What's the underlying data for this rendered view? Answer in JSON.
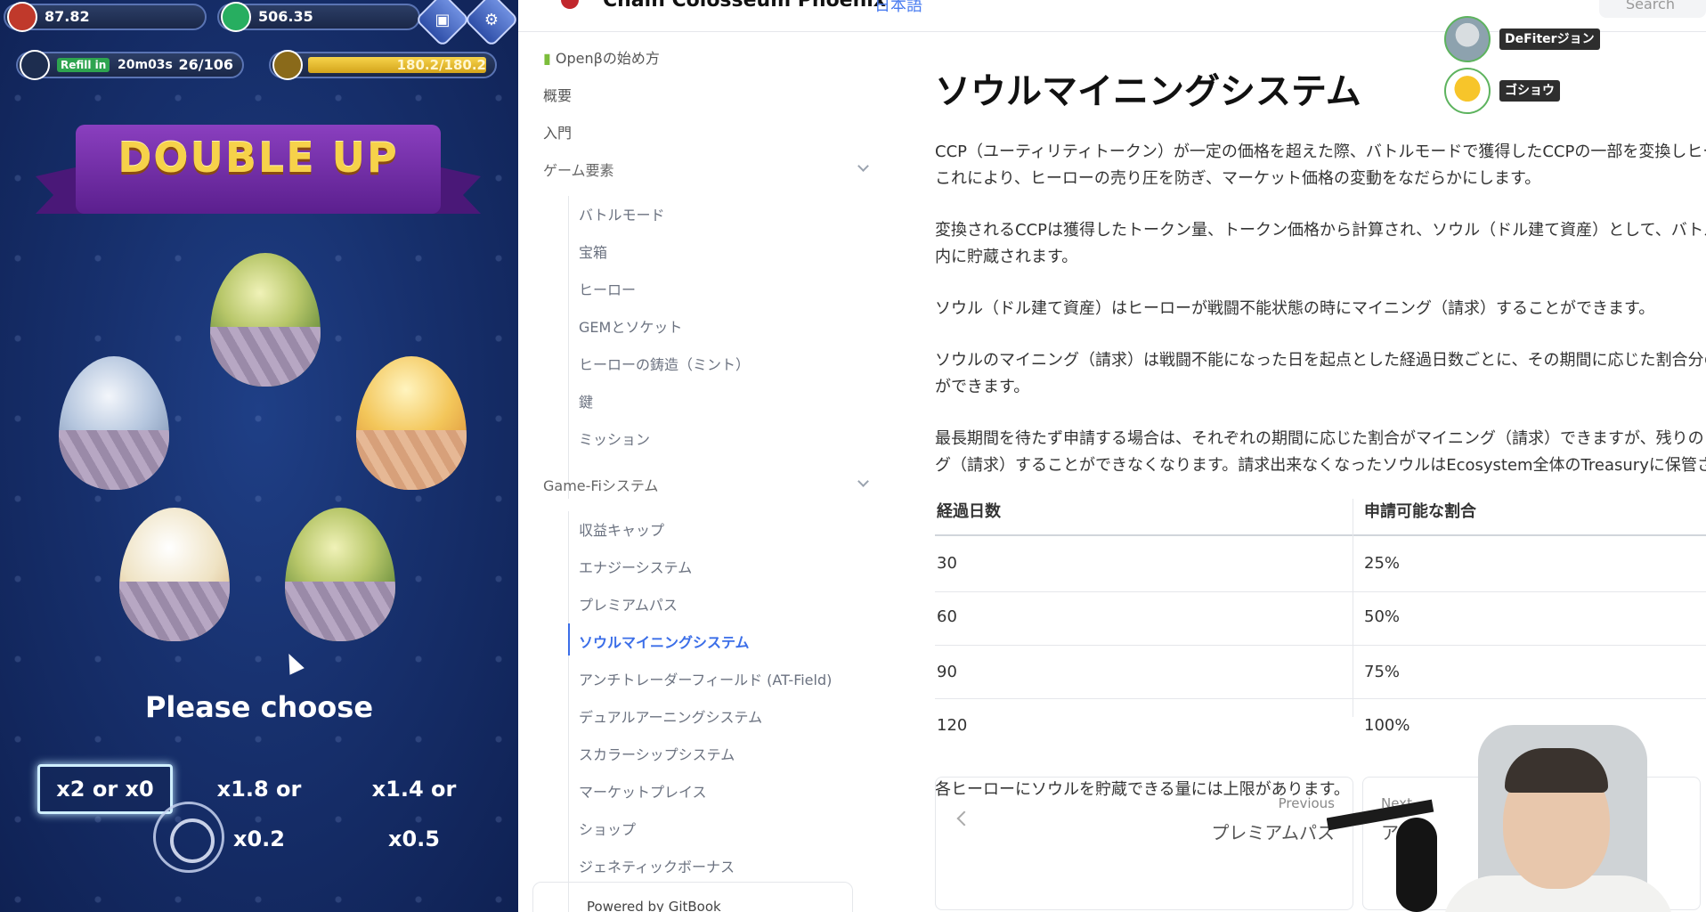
{
  "game": {
    "hud": {
      "stat1": "87.82",
      "stat2": "506.35",
      "refill_label": "Refill in",
      "refill_time": "20m03s",
      "energy": "26/106",
      "gauge": "180.2/180.2",
      "gauge_fill": 1.0
    },
    "banner": "DOUBLE UP",
    "prompt": "Please choose",
    "choices": [
      {
        "label": "x2 or x0"
      },
      {
        "label": "x1.8 or x0.2"
      },
      {
        "label": "x1.4 or x0.5"
      }
    ]
  },
  "docs": {
    "header": {
      "title": "Chain Colosseum Phoenix",
      "lang": "日本語",
      "search_placeholder": "Search"
    },
    "sidebar": {
      "items": [
        {
          "label": "Openβの始め方"
        },
        {
          "label": "概要"
        },
        {
          "label": "入門"
        },
        {
          "label": "ゲーム要素"
        },
        {
          "label": "バトルモード"
        },
        {
          "label": "宝箱"
        },
        {
          "label": "ヒーロー"
        },
        {
          "label": "GEMとソケット"
        },
        {
          "label": "ヒーローの鋳造（ミント）"
        },
        {
          "label": "鍵"
        },
        {
          "label": "ミッション"
        },
        {
          "label": "Game-Fiシステム"
        },
        {
          "label": "収益キャップ"
        },
        {
          "label": "エナジーシステム"
        },
        {
          "label": "プレミアムパス"
        },
        {
          "label": "ソウルマイニングシステム"
        },
        {
          "label": "アンチトレーダーフィールド (AT-Field)"
        },
        {
          "label": "デュアルアーニングシステム"
        },
        {
          "label": "スカラーシップシステム"
        },
        {
          "label": "マーケットプレイス"
        },
        {
          "label": "ショップ"
        },
        {
          "label": "ジェネティックボーナス"
        }
      ],
      "powered_by": "Powered by GitBook"
    },
    "content": {
      "title": "ソウルマイニングシステム",
      "p1a": "CCP（ユーティリティトークン）が一定の価格を超えた際、バトルモードで獲得したCCPの一部を変換しヒーローに貯",
      "p1b": "これにより、ヒーローの売り圧を防ぎ、マーケット価格の変動をなだらかにします。",
      "p2a": "変換されるCCPは獲得したトークン量、トークン価格から計算され、ソウル（ドル建て資産）として、バトルに使用し",
      "p2b": "内に貯蔵されます。",
      "p3": "ソウル（ドル建て資産）はヒーローが戦闘不能状態の時にマイニング（請求）することができます。",
      "p4a": "ソウルのマイニング（請求）は戦闘不能になった日を起点とした経過日数ごとに、その期間に応じた割合分の申請",
      "p4b": "ができます。",
      "p5a": "最長期間を待たず申請する場合は、それぞれの期間に応じた割合がマイニング（請求）できますが、残りのソウル",
      "p5b": "グ（請求）することができなくなります。請求出来なくなったソウルはEcosystem全体のTreasuryに保管されます",
      "table": {
        "headers": [
          "経過日数",
          "申請可能な割合"
        ],
        "rows": [
          [
            "30",
            "25%"
          ],
          [
            "60",
            "50%"
          ],
          [
            "90",
            "75%"
          ],
          [
            "120",
            "100%"
          ]
        ]
      },
      "note": "各ヒーローにソウルを貯蔵できる量には上限があります。",
      "prev_label": "Previous",
      "prev_title": "プレミアムパス",
      "next_label": "Next",
      "next_title": "アンチ"
    },
    "viewers": [
      {
        "name": "DeFiterジョン"
      },
      {
        "name": "ゴショウ"
      }
    ]
  }
}
